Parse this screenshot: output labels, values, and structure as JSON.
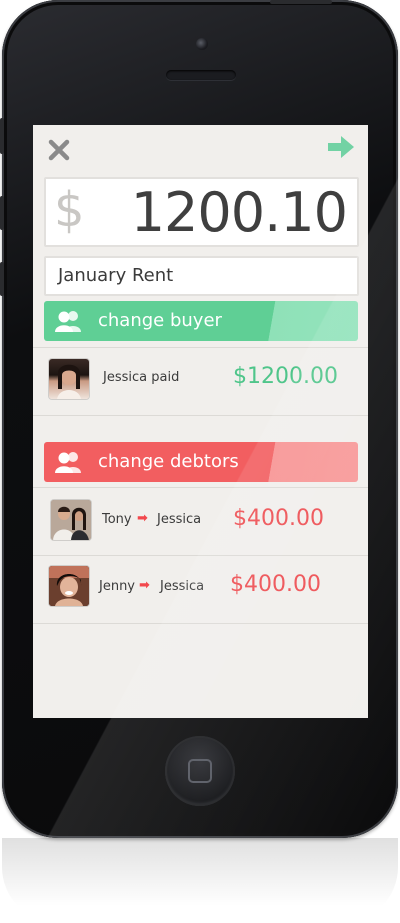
{
  "header": {
    "close_icon": "close-icon",
    "next_icon": "arrow-right-icon",
    "accent_green": "#5fcf95"
  },
  "amount": {
    "currency": "$",
    "value": "1200.10"
  },
  "description": {
    "value": "January Rent"
  },
  "buyer": {
    "button_label": "change buyer",
    "icon": "people-icon",
    "color": "#5fcf95",
    "rows": [
      {
        "name": "Jessica paid",
        "amount": "$1200.00"
      }
    ]
  },
  "debtors": {
    "button_label": "change debtors",
    "icon": "people-icon",
    "color": "#f25e60",
    "rows": [
      {
        "from": "Tony",
        "to": "Jessica",
        "amount": "$400.00"
      },
      {
        "from": "Jenny",
        "to": "Jessica",
        "amount": "$400.00"
      }
    ]
  }
}
